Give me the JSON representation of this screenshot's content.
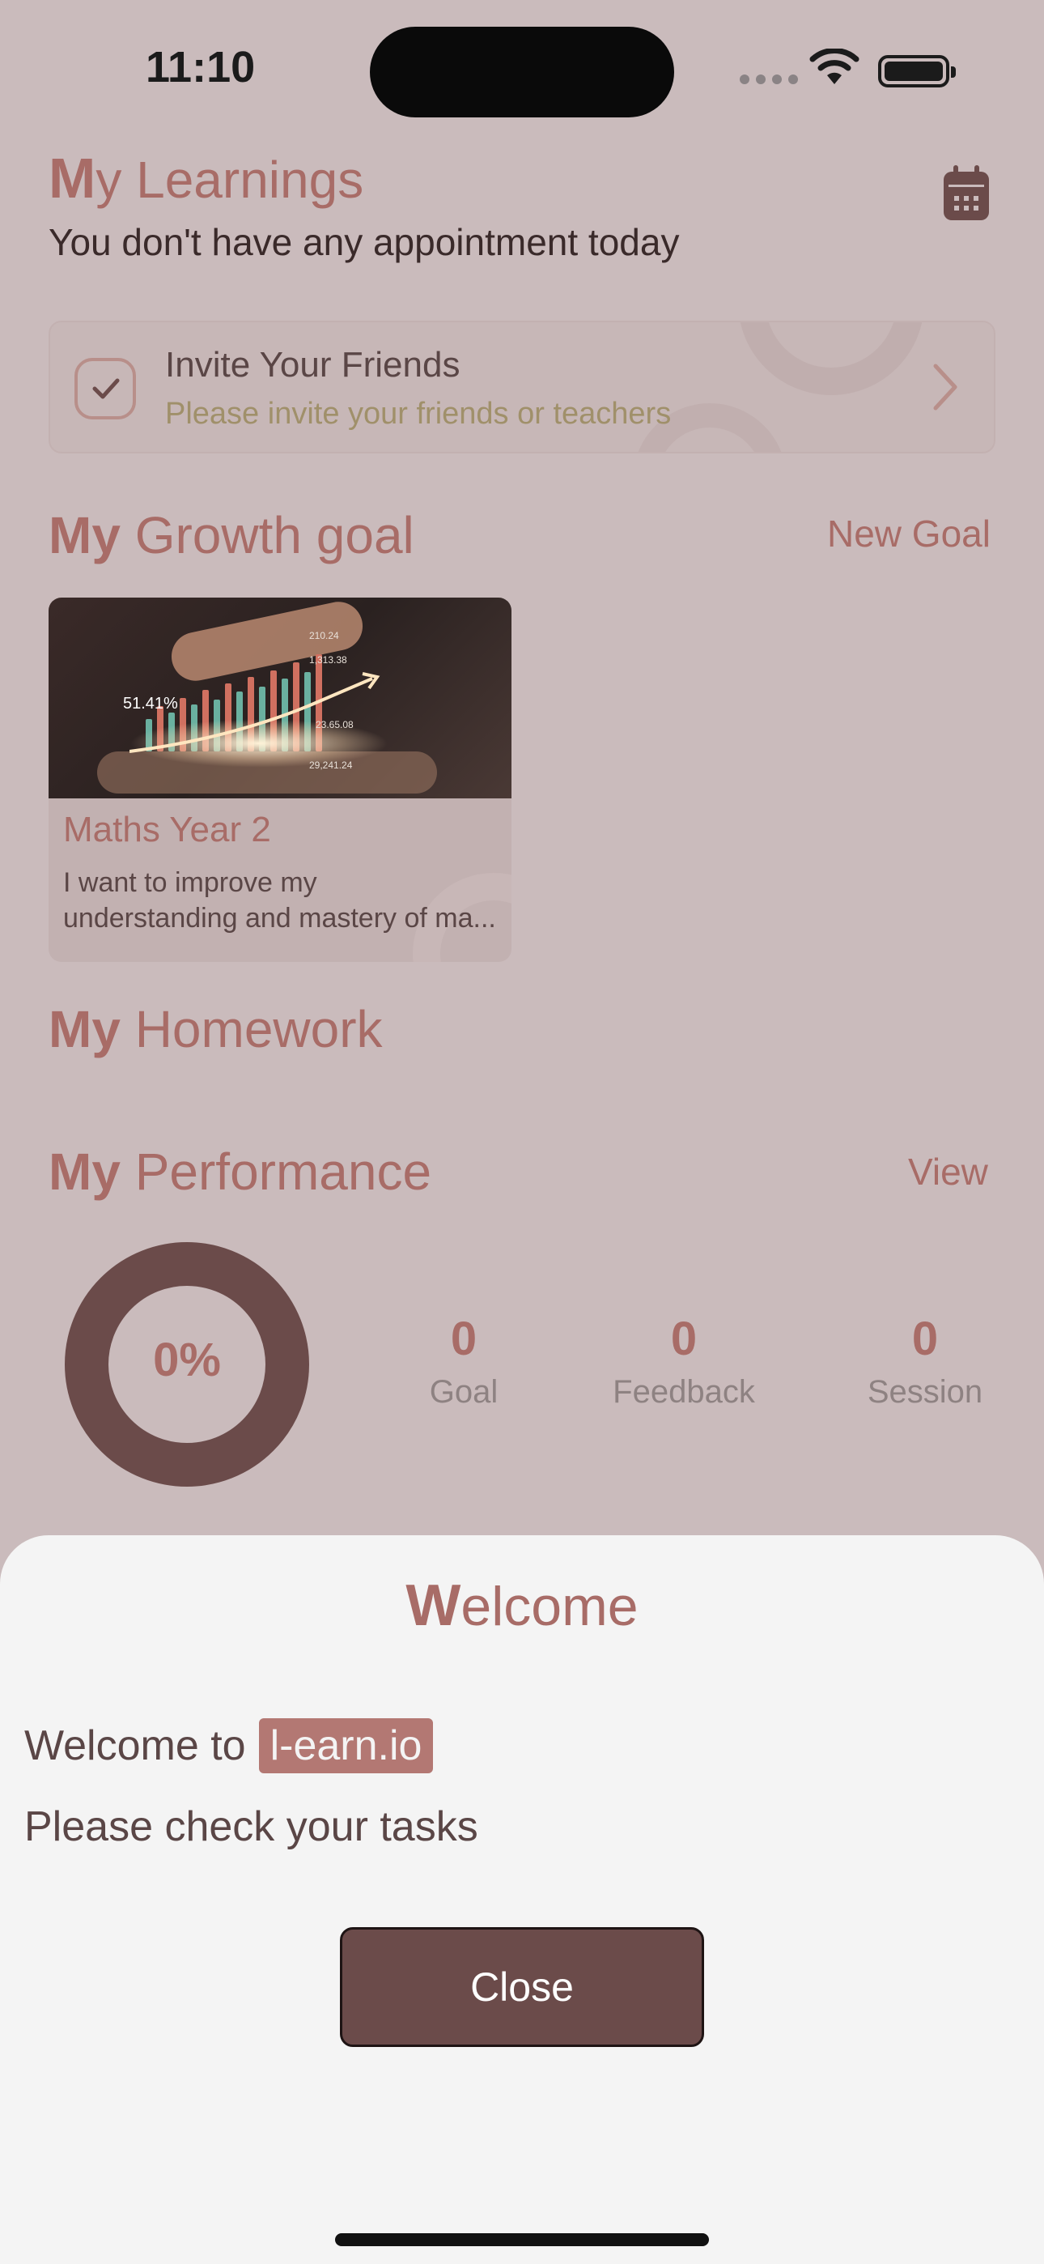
{
  "status_bar": {
    "time": "11:10"
  },
  "learnings": {
    "title_first": "M",
    "title_rest": "y Learnings",
    "subtitle": "You don't have any appointment today"
  },
  "invite": {
    "title": "Invite Your Friends",
    "subtitle": "Please invite your friends or teachers"
  },
  "growth": {
    "title_bold": "My",
    "title_rest": " Growth goal",
    "new_goal_label": "New Goal",
    "card": {
      "image_caption": "51.41%",
      "name": "Maths Year 2",
      "description_line1": "I want to improve my",
      "description_line2": "understanding and mastery of ma..."
    }
  },
  "homework": {
    "title_bold": "My",
    "title_rest": " Homework"
  },
  "performance": {
    "title_bold": "My",
    "title_rest": " Performance",
    "view_label": "View",
    "progress": "0%",
    "stats": [
      {
        "value": "0",
        "label": "Goal"
      },
      {
        "value": "0",
        "label": "Feedback"
      },
      {
        "value": "0",
        "label": "Session"
      }
    ]
  },
  "welcome_sheet": {
    "title_first": "W",
    "title_rest": "elcome",
    "welcome_prefix": "Welcome to",
    "brand": "l-earn.io",
    "message": "Please check your tasks",
    "close_label": "Close"
  },
  "colors": {
    "accent": "#a86c67",
    "dark_brown": "#6b4b4a",
    "overlay_bg": "#cabbbc",
    "sheet_bg": "#f4f4f4"
  }
}
